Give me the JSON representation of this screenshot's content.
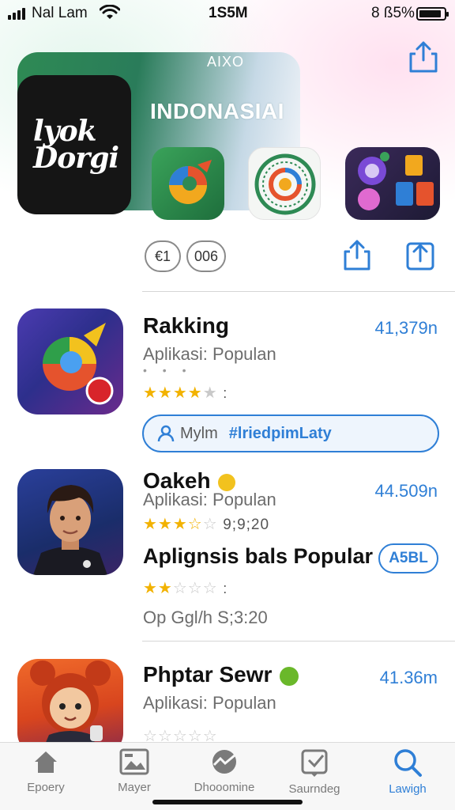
{
  "status": {
    "carrier": "Nal Lam",
    "time": "1S5M",
    "battery": "8 ß5%"
  },
  "hero": {
    "tag": "AIXO",
    "logo_line1": "lyok",
    "logo_line2": "Dorgi",
    "title": "INDONASIAI"
  },
  "actions": {
    "btn_a": "€1",
    "btn_b": "006"
  },
  "apps": [
    {
      "name": "Rakking",
      "subtitle": "Aplikasi: Populan",
      "faint": "• • •",
      "size": "41,379n",
      "rating": 4,
      "rating_extra": ":"
    },
    {
      "name": "Oakeh",
      "subtitle": "Aplikasi: Populan",
      "size": "44.509n",
      "rating": 3.5,
      "rating_extra": "9;9;20"
    },
    {
      "name": "Phptar Sewr",
      "subtitle": "Aplikasi: Populan",
      "size": "41.36m",
      "rating": 0
    }
  ],
  "search_pill": {
    "label": "Mylm",
    "tag": "#lriedpimLaty"
  },
  "aux": {
    "title": "Aplignsis bals Popular",
    "button": "A5BL",
    "rating": 2,
    "rating_extra": ":",
    "meta": "Op Ggl/h S;3:20"
  },
  "tabs": [
    {
      "label": "Epoery",
      "icon": "home-icon",
      "active": false
    },
    {
      "label": "Mayer",
      "icon": "image-icon",
      "active": false
    },
    {
      "label": "Dhooomine",
      "icon": "globe-icon",
      "active": false
    },
    {
      "label": "Saurndeg",
      "icon": "download-icon",
      "active": false
    },
    {
      "label": "Lawigh",
      "icon": "search-icon",
      "active": true
    }
  ],
  "colors": {
    "accent": "#2f7fd6",
    "star": "#f2b200",
    "hero_green": "#2e8a54"
  }
}
